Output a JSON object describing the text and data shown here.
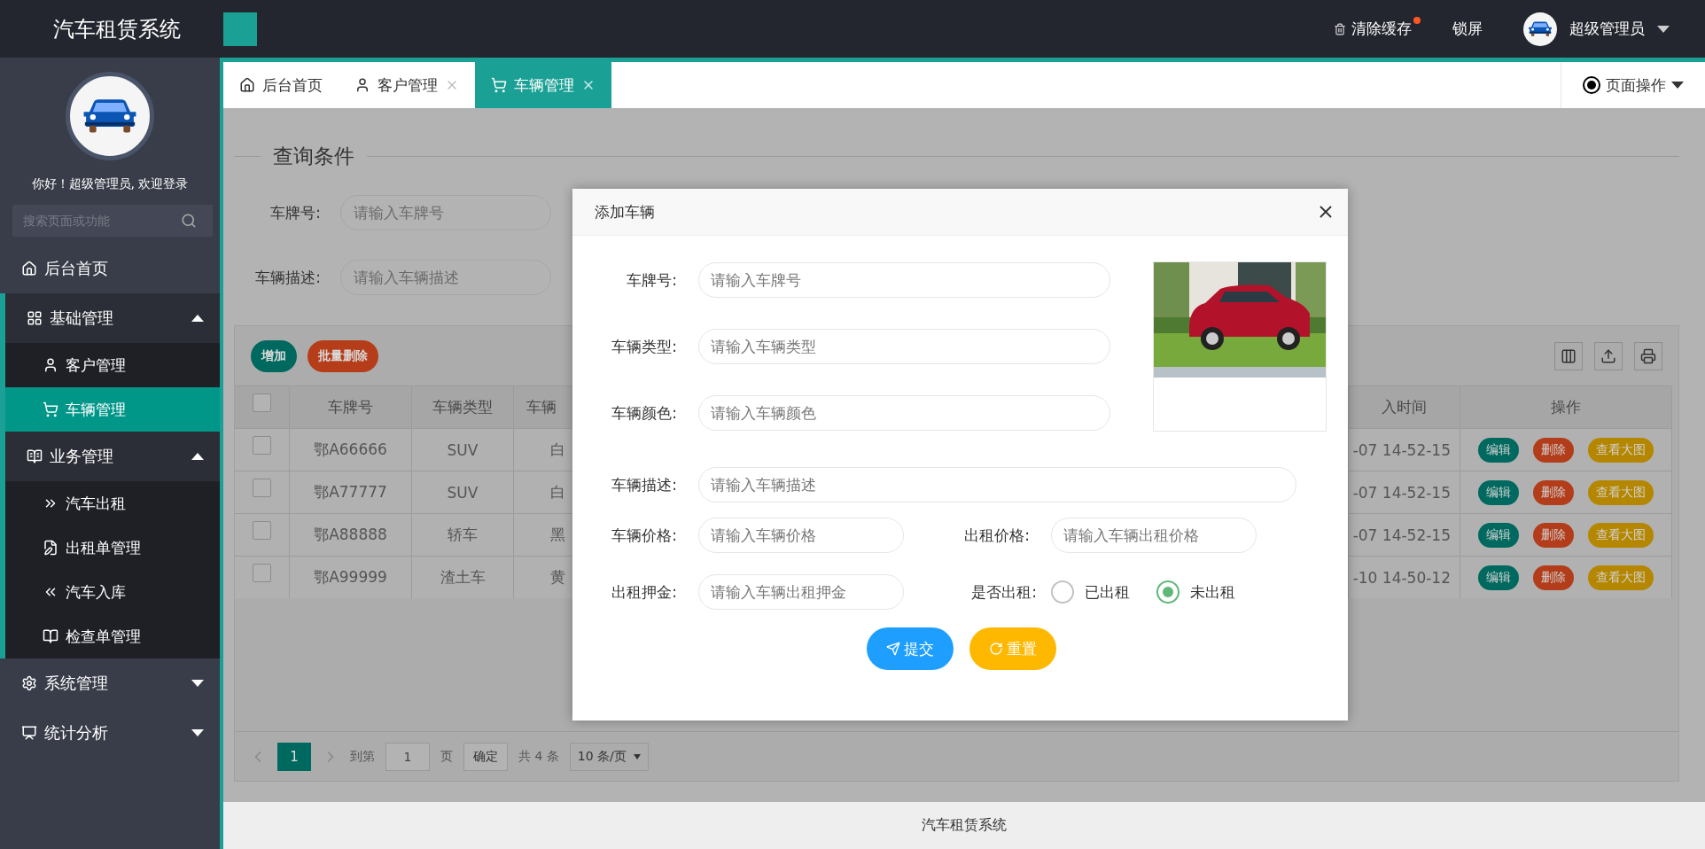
{
  "header": {
    "logo": "汽车租赁系统",
    "actions": [
      {
        "label": "清除缓存",
        "dot": true
      },
      {
        "label": "锁屏",
        "dot": false
      }
    ],
    "user": "超级管理员"
  },
  "sidebar": {
    "welcome": "你好！超级管理员, 欢迎登录",
    "search": {
      "placeholder": "搜索页面或功能"
    },
    "menu": [
      {
        "label": "后台首页",
        "kind": "link",
        "selected": false
      },
      {
        "label": "基础管理",
        "kind": "group",
        "selected": false,
        "expanded": true,
        "children": [
          {
            "label": "客户管理",
            "selected": false
          },
          {
            "label": "车辆管理",
            "selected": true
          }
        ]
      },
      {
        "label": "业务管理",
        "kind": "group",
        "selected": false,
        "expanded": true,
        "children": [
          {
            "label": "汽车出租",
            "selected": false
          },
          {
            "label": "出租单管理",
            "selected": false
          },
          {
            "label": "汽车入库",
            "selected": false
          },
          {
            "label": "检查单管理",
            "selected": false
          }
        ]
      },
      {
        "label": "系统管理",
        "kind": "group",
        "selected": false,
        "expanded": false
      },
      {
        "label": "统计分析",
        "kind": "group",
        "selected": false,
        "expanded": false
      }
    ]
  },
  "tabs": [
    {
      "label": "后台首页",
      "selected": false,
      "closable": false
    },
    {
      "label": "客户管理",
      "selected": false,
      "closable": true
    },
    {
      "label": "车辆管理",
      "selected": true,
      "closable": true
    }
  ],
  "page_menu": "页面操作",
  "query": {
    "legend": "查询条件",
    "fields": [
      {
        "label": "车牌号:",
        "placeholder": "请输入车牌号"
      },
      {
        "label": "车辆描述:",
        "placeholder": "请输入车辆描述"
      }
    ]
  },
  "toolbar": {
    "buttons": [
      "增加",
      "批量删除"
    ]
  },
  "table": {
    "header_checked": false,
    "columns": [
      "车牌号",
      "车辆类型",
      "车辆",
      "入时间",
      "操作"
    ],
    "rows": [
      {
        "checked": false,
        "cells": [
          "鄂A66666",
          "SUV",
          "白",
          "-07 14-52-15"
        ],
        "actions": [
          "编辑",
          "删除",
          "查看大图"
        ]
      },
      {
        "checked": false,
        "cells": [
          "鄂A77777",
          "SUV",
          "白",
          "-07 14-52-15"
        ],
        "actions": [
          "编辑",
          "删除",
          "查看大图"
        ]
      },
      {
        "checked": false,
        "cells": [
          "鄂A88888",
          "轿车",
          "黑",
          "-07 14-52-15"
        ],
        "actions": [
          "编辑",
          "删除",
          "查看大图"
        ]
      },
      {
        "checked": false,
        "cells": [
          "鄂A99999",
          "渣土车",
          "黄",
          "-10 14-50-12"
        ],
        "actions": [
          "编辑",
          "删除",
          "查看大图"
        ]
      }
    ]
  },
  "pagination": {
    "pages": [
      {
        "label": "1",
        "selected": true
      }
    ],
    "goto": "到第",
    "page_value": "1",
    "page_unit": "页",
    "confirm": "确定",
    "total": "共 4 条",
    "page_size": "10 条/页"
  },
  "dialog": {
    "title": "添加车辆",
    "fields": [
      {
        "label": "车牌号:",
        "placeholder": "请输入车牌号"
      },
      {
        "label": "车辆类型:",
        "placeholder": "请输入车辆类型"
      },
      {
        "label": "车辆颜色:",
        "placeholder": "请输入车辆颜色"
      }
    ],
    "description": {
      "label": "车辆描述:",
      "placeholder": "请输入车辆描述"
    },
    "price": {
      "label": "车辆价格:",
      "placeholder": "请输入车辆价格"
    },
    "rent_price": {
      "label": "出租价格:",
      "placeholder": "请输入车辆出租价格"
    },
    "deposit": {
      "label": "出租押金:",
      "placeholder": "请输入车辆出租押金"
    },
    "rented": {
      "label": "是否出租:",
      "options": [
        {
          "label": "已出租",
          "selected": false
        },
        {
          "label": "未出租",
          "selected": true
        }
      ]
    },
    "buttons": [
      "提交",
      "重置"
    ]
  },
  "footer": "汽车租赁系统"
}
